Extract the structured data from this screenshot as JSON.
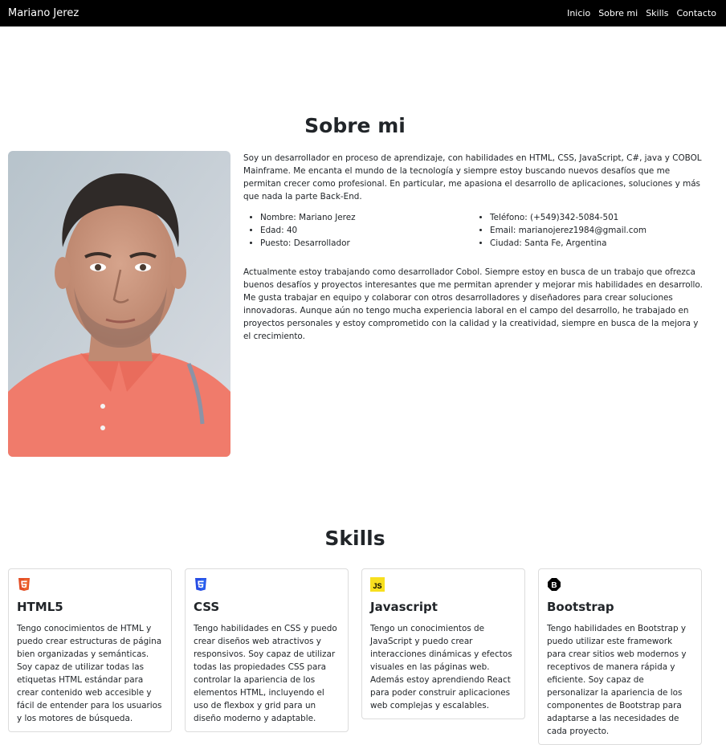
{
  "nav": {
    "brand": "Mariano Jerez",
    "links": [
      "Inicio",
      "Sobre mi",
      "Skills",
      "Contacto"
    ]
  },
  "about": {
    "title": "Sobre mi",
    "intro": "Soy un desarrollador en proceso de aprendizaje, con habilidades en HTML, CSS, JavaScript, C#, java y COBOL Mainframe. Me encanta el mundo de la tecnología y siempre estoy buscando nuevos desafíos que me permitan crecer como profesional. En particular, me apasiona el desarrollo de aplicaciones, soluciones y más que nada la parte Back-End.",
    "info_left": [
      {
        "label": "Nombre:",
        "value": "Mariano Jerez"
      },
      {
        "label": "Edad:",
        "value": "40"
      },
      {
        "label": "Puesto:",
        "value": "Desarrollador"
      }
    ],
    "info_right": [
      {
        "label": "Teléfono:",
        "value": "(+549)342-5084-501"
      },
      {
        "label": "Email:",
        "value": "marianojerez1984@gmail.com"
      },
      {
        "label": "Ciudad:",
        "value": "Santa Fe, Argentina"
      }
    ],
    "outro": "Actualmente estoy trabajando como desarrollador Cobol. Siempre estoy en busca de un trabajo que ofrezca buenos desafíos y proyectos interesantes que me permitan aprender y mejorar mis habilidades en desarrollo. Me gusta trabajar en equipo y colaborar con otros desarrolladores y diseñadores para crear soluciones innovadoras. Aunque aún no tengo mucha experiencia laboral en el campo del desarrollo, he trabajado en proyectos personales y estoy comprometido con la calidad y la creatividad, siempre en busca de la mejora y el crecimiento."
  },
  "skills": {
    "title": "Skills",
    "cards": [
      {
        "name": "HTML5",
        "icon": "html5-icon",
        "color": "#e34f26",
        "text": "Tengo conocimientos de HTML y puedo crear estructuras de página bien organizadas y semánticas. Soy capaz de utilizar todas las etiquetas HTML estándar para crear contenido web accesible y fácil de entender para los usuarios y los motores de búsqueda."
      },
      {
        "name": "CSS",
        "icon": "css3-icon",
        "color": "#264de4",
        "text": "Tengo habilidades en CSS y puedo crear diseños web atractivos y responsivos. Soy capaz de utilizar todas las propiedades CSS para controlar la apariencia de los elementos HTML, incluyendo el uso de flexbox y grid para un diseño moderno y adaptable."
      },
      {
        "name": "Javascript",
        "icon": "javascript-icon",
        "color": "#f7df1e",
        "badge": "JS",
        "text": "Tengo un conocimientos de JavaScript y puedo crear interacciones dinámicas y efectos visuales en las páginas web. Además estoy aprendiendo React para poder construir aplicaciones web complejas y escalables."
      },
      {
        "name": "Bootstrap",
        "icon": "bootstrap-icon",
        "color": "#000000",
        "badge": "B",
        "text": "Tengo habilidades en Bootstrap y puedo utilizar este framework para crear sitios web modernos y receptivos de manera rápida y eficiente. Soy capaz de personalizar la apariencia de los componentes de Bootstrap para adaptarse a las necesidades de cada proyecto."
      }
    ]
  }
}
